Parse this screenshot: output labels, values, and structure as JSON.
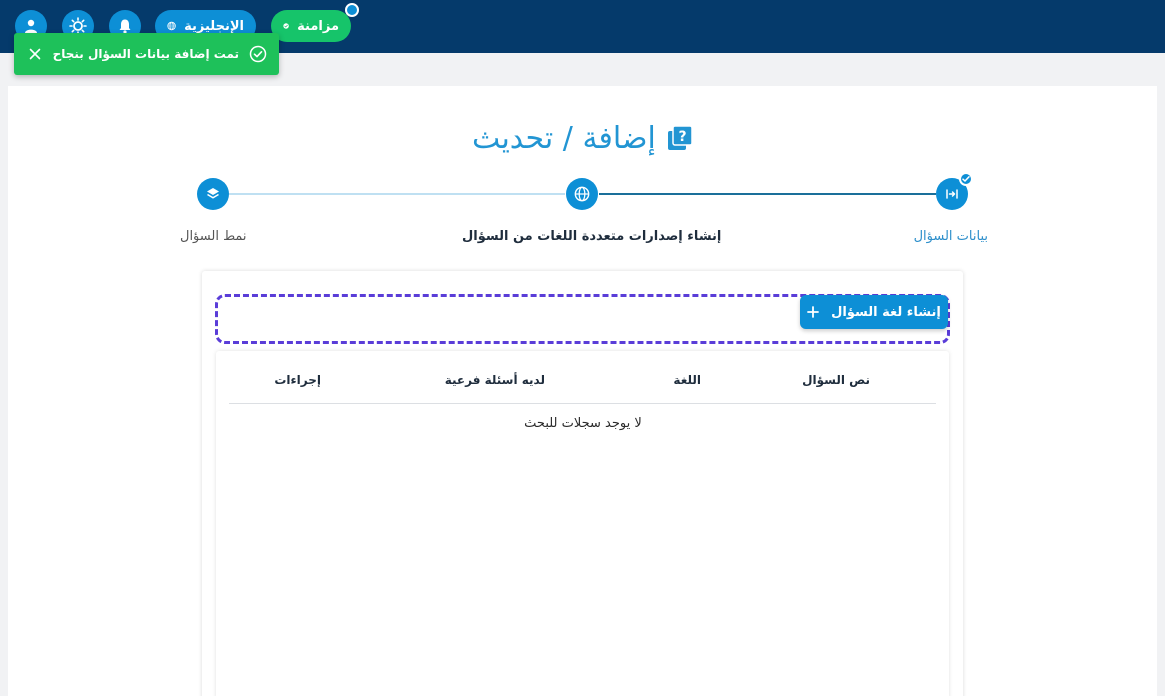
{
  "header": {
    "language_label": "الإنجليزية",
    "sync_label": "مزامنة",
    "icons": [
      "user-icon",
      "sun-icon",
      "bell-icon",
      "globe-icon",
      "check-circle-icon"
    ]
  },
  "toast": {
    "message": "تمت إضافة بيانات السؤال بنجاح",
    "color": "#1ec15a"
  },
  "page": {
    "title": "إضافة / تحديث",
    "accent_color": "#0d8fd6"
  },
  "steps": [
    {
      "label": "بيانات السؤال",
      "icon": "arrows-icon",
      "state": "completed"
    },
    {
      "label": "إنشاء إصدارات متعددة اللغات من السؤال",
      "icon": "globe-icon",
      "state": "active"
    },
    {
      "label": "نمط السؤال",
      "icon": "layers-icon",
      "state": "pending"
    }
  ],
  "actions": {
    "create_language_label": "إنشاء لغة السؤال"
  },
  "table": {
    "columns": [
      "نص السؤال",
      "اللغة",
      "لديه أسئلة فرعية",
      "إجراءات"
    ],
    "empty_message": "لا يوجد سجلات للبحث"
  }
}
